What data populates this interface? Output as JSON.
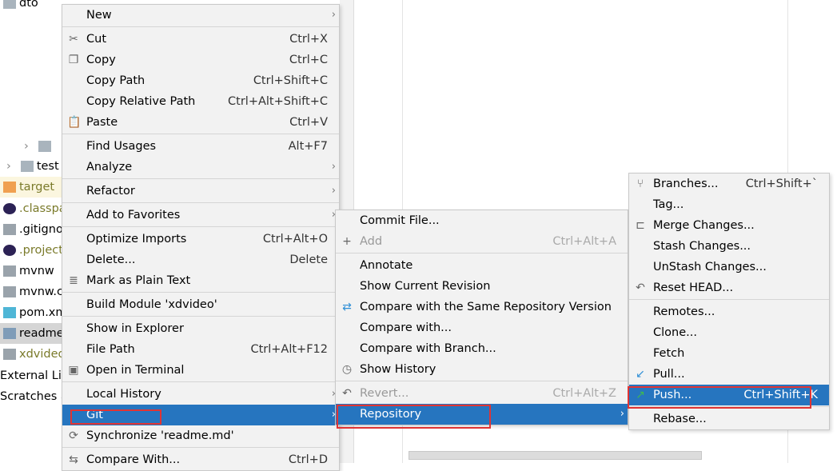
{
  "tree": [
    {
      "label": "dto",
      "icon": "folder-icon"
    },
    {
      "label": "",
      "icon": "folder-icon"
    },
    {
      "label": "test",
      "icon": "folder-icon"
    },
    {
      "label": "target",
      "icon": "folder-orange-icon"
    },
    {
      "label": ".classpath",
      "icon": "eclipse-icon"
    },
    {
      "label": ".gitignore",
      "icon": "gitignore-file-icon"
    },
    {
      "label": ".project",
      "icon": "eclipse-icon"
    },
    {
      "label": "mvnw",
      "icon": "shell-file-icon"
    },
    {
      "label": "mvnw.cmd",
      "icon": "text-file-icon"
    },
    {
      "label": "pom.xml",
      "icon": "maven-icon"
    },
    {
      "label": "readme.md",
      "icon": "markdown-file-icon"
    },
    {
      "label": "xdvideo.iml",
      "icon": "iml-file-icon"
    },
    {
      "label": "External Libraries",
      "icon": ""
    },
    {
      "label": "Scratches and Consoles",
      "icon": ""
    }
  ],
  "menu_main": [
    {
      "label": "New",
      "submenu": true
    },
    {
      "sep": true
    },
    {
      "label": "Cut",
      "shortcut": "Ctrl+X",
      "icon": "scissors-icon",
      "glyph": "✂"
    },
    {
      "label": "Copy",
      "shortcut": "Ctrl+C",
      "icon": "copy-icon",
      "glyph": "❐"
    },
    {
      "label": "Copy Path",
      "shortcut": "Ctrl+Shift+C"
    },
    {
      "label": "Copy Relative Path",
      "shortcut": "Ctrl+Alt+Shift+C"
    },
    {
      "label": "Paste",
      "shortcut": "Ctrl+V",
      "icon": "clipboard-icon",
      "glyph": "📋"
    },
    {
      "sep": true
    },
    {
      "label": "Find Usages",
      "shortcut": "Alt+F7"
    },
    {
      "label": "Analyze",
      "submenu": true
    },
    {
      "sep": true
    },
    {
      "label": "Refactor",
      "submenu": true
    },
    {
      "sep": true
    },
    {
      "label": "Add to Favorites",
      "submenu": true
    },
    {
      "sep": true
    },
    {
      "label": "Optimize Imports",
      "shortcut": "Ctrl+Alt+O"
    },
    {
      "label": "Delete...",
      "shortcut": "Delete"
    },
    {
      "label": "Mark as Plain Text",
      "icon": "plain-text-icon",
      "glyph": "≣"
    },
    {
      "sep": true
    },
    {
      "label": "Build Module 'xdvideo'"
    },
    {
      "sep": true
    },
    {
      "label": "Show in Explorer"
    },
    {
      "label": "File Path",
      "shortcut": "Ctrl+Alt+F12"
    },
    {
      "label": "Open in Terminal",
      "icon": "terminal-icon",
      "glyph": "▣"
    },
    {
      "sep": true
    },
    {
      "label": "Local History",
      "submenu": true
    },
    {
      "label": "Git",
      "submenu": true,
      "selected": true
    },
    {
      "label": "Synchronize 'readme.md'",
      "icon": "sync-icon",
      "glyph": "⟳"
    },
    {
      "sep": true
    },
    {
      "label": "Compare With...",
      "shortcut": "Ctrl+D",
      "icon": "compare-icon",
      "glyph": "⇆"
    }
  ],
  "menu_git": [
    {
      "label": "Commit File..."
    },
    {
      "label": "Add",
      "shortcut": "Ctrl+Alt+A",
      "disabled": true,
      "icon": "plus-icon",
      "glyph": "+"
    },
    {
      "sep": true
    },
    {
      "label": "Annotate"
    },
    {
      "label": "Show Current Revision"
    },
    {
      "label": "Compare with the Same Repository Version",
      "icon": "compare-arrows-icon",
      "glyph": "⇄"
    },
    {
      "label": "Compare with..."
    },
    {
      "label": "Compare with Branch..."
    },
    {
      "label": "Show History",
      "icon": "clock-icon",
      "glyph": "◷"
    },
    {
      "sep": true
    },
    {
      "label": "Revert...",
      "shortcut": "Ctrl+Alt+Z",
      "disabled": true,
      "icon": "undo-icon",
      "glyph": "↶"
    },
    {
      "label": "Repository",
      "submenu": true,
      "selected": true
    }
  ],
  "menu_repo": [
    {
      "label": "Branches...",
      "shortcut": "Ctrl+Shift+`",
      "icon": "branch-icon",
      "glyph": "⑂"
    },
    {
      "label": "Tag..."
    },
    {
      "label": "Merge Changes...",
      "icon": "merge-icon",
      "glyph": "⊏"
    },
    {
      "label": "Stash Changes..."
    },
    {
      "label": "UnStash Changes..."
    },
    {
      "label": "Reset HEAD...",
      "icon": "reset-icon",
      "glyph": "↶"
    },
    {
      "sep": true
    },
    {
      "label": "Remotes..."
    },
    {
      "label": "Clone..."
    },
    {
      "label": "Fetch"
    },
    {
      "label": "Pull...",
      "icon": "pull-arrow-icon",
      "glyph": "↙"
    },
    {
      "label": "Push...",
      "shortcut": "Ctrl+Shift+K",
      "icon": "push-arrow-icon",
      "glyph": "↗",
      "selected": true
    },
    {
      "sep": true
    },
    {
      "label": "Rebase..."
    }
  ],
  "colors": {
    "selection": "#2675bf",
    "highlight_box": "#e03434",
    "menu_bg": "#f2f2f2"
  }
}
